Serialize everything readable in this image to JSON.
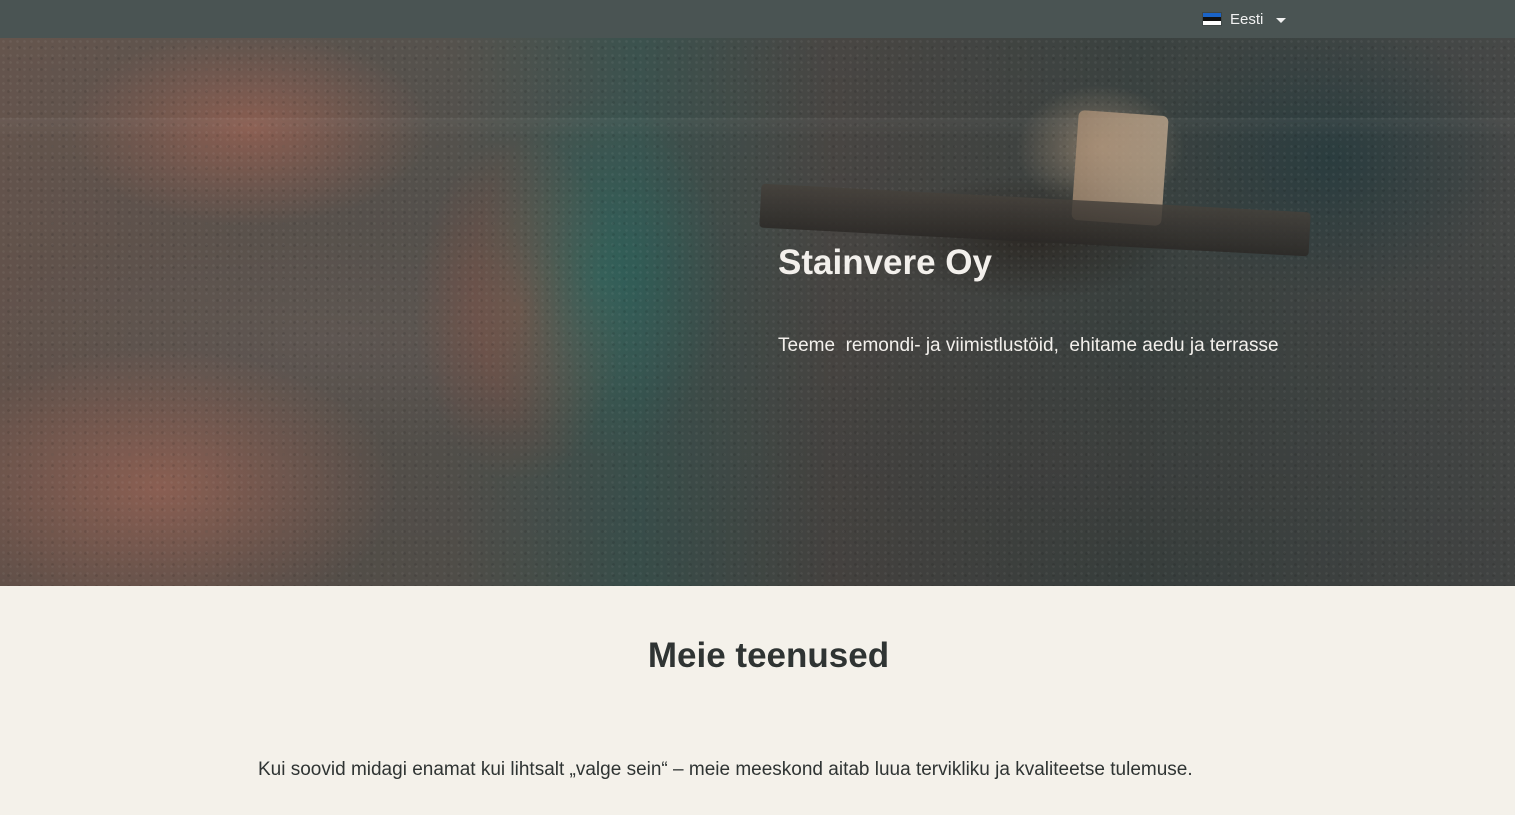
{
  "topbar": {
    "language": {
      "label": "Eesti",
      "flag_icon": "estonian-flag-icon",
      "flag_colors": [
        "#1a63c7",
        "#111111",
        "#ffffff"
      ],
      "dropdown_icon": "caret-down-icon"
    }
  },
  "hero": {
    "title": "Stainvere Oy",
    "subtitle": "Teeme  remondi- ja viimistlustöid,  ehitame aedu ja terrasse"
  },
  "services": {
    "heading": "Meie teenused",
    "intro": "Kui soovid midagi enamat kui lihtsalt „valge sein“ – meie meeskond aitab luua tervikliku ja kvaliteetse tulemuse."
  },
  "colors": {
    "topbar_bg": "#4a5453",
    "page_bg": "#f4f1ea",
    "text_dark": "#2f3433",
    "hero_text": "#f3f0ec"
  }
}
